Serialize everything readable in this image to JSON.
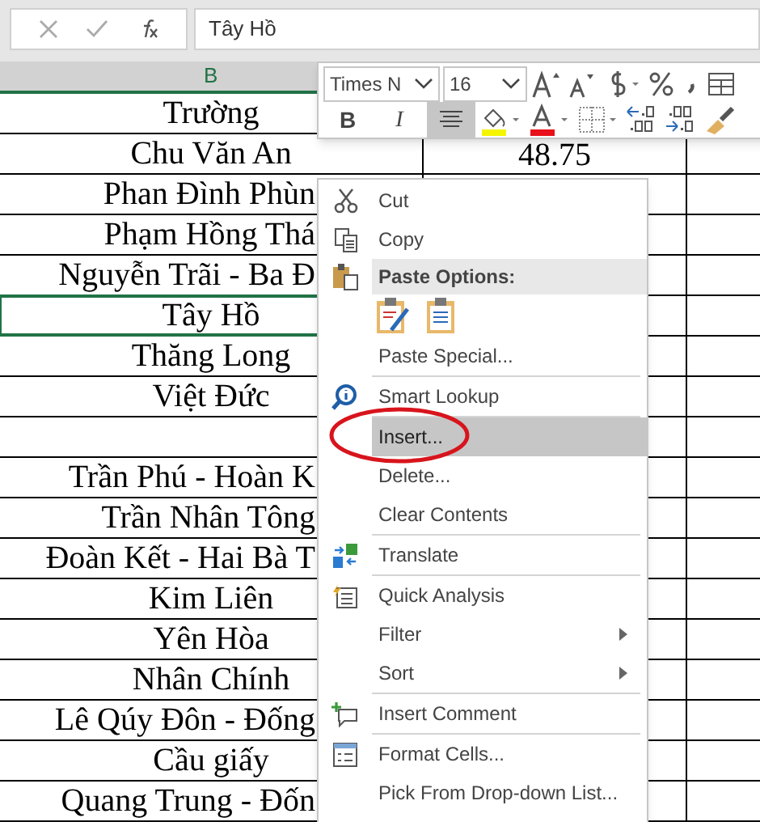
{
  "formula_bar": {
    "value": "Tây Hồ"
  },
  "column_header": {
    "label": "B",
    "selected": true
  },
  "rows": [
    {
      "col_b": "Trường",
      "selected": false
    },
    {
      "col_b": "Chu Văn An",
      "col_c": "48.75",
      "selected": false
    },
    {
      "col_b": "Phan Đình Phùn",
      "selected": false
    },
    {
      "col_b": "Phạm Hồng Thá",
      "selected": false
    },
    {
      "col_b": "Nguyễn Trãi - Ba Đ",
      "selected": false
    },
    {
      "col_b": "Tây Hồ",
      "selected": true
    },
    {
      "col_b": "Thăng Long",
      "selected": false
    },
    {
      "col_b": "Việt Đức",
      "selected": false
    },
    {
      "selected": false
    },
    {
      "col_b": "Trần Phú - Hoàn K",
      "selected": false
    },
    {
      "col_b": "Trần Nhân Tông",
      "selected": false
    },
    {
      "col_b": "Đoàn Kết - Hai Bà T",
      "selected": false
    },
    {
      "col_b": "Kim Liên",
      "selected": false
    },
    {
      "col_b": "Yên Hòa",
      "selected": false
    },
    {
      "col_b": "Nhân Chính",
      "selected": false
    },
    {
      "col_b": "Lê Qúy Đôn - Đống",
      "selected": false
    },
    {
      "col_b": "Cầu giấy",
      "selected": false
    },
    {
      "col_b": "Quang Trung - Đốn",
      "selected": false
    }
  ],
  "mini_toolbar": {
    "font": "Times N",
    "size": "16",
    "format_buttons": [
      {
        "kind": "bold",
        "label": "B",
        "selected": false
      },
      {
        "kind": "italic",
        "label": "I",
        "selected": false
      },
      {
        "kind": "center",
        "selected": true
      }
    ]
  },
  "context_menu": [
    {
      "kind": "command",
      "label": "Cut",
      "selected": false,
      "submenu": false
    },
    {
      "kind": "command",
      "label": "Copy",
      "selected": false,
      "submenu": false
    },
    {
      "kind": "header",
      "label": "Paste Options:"
    },
    {
      "kind": "paste-icons"
    },
    {
      "kind": "command",
      "label": "Paste Special...",
      "selected": false,
      "submenu": false
    },
    {
      "kind": "separator"
    },
    {
      "kind": "command",
      "label": "Smart Lookup",
      "selected": false,
      "submenu": false
    },
    {
      "kind": "separator"
    },
    {
      "kind": "command",
      "label": "Insert...",
      "selected": true,
      "submenu": false
    },
    {
      "kind": "command",
      "label": "Delete...",
      "selected": false,
      "submenu": false
    },
    {
      "kind": "command",
      "label": "Clear Contents",
      "selected": false,
      "submenu": false
    },
    {
      "kind": "separator"
    },
    {
      "kind": "command",
      "label": "Translate",
      "selected": false,
      "submenu": false
    },
    {
      "kind": "separator"
    },
    {
      "kind": "command",
      "label": "Quick Analysis",
      "selected": false,
      "submenu": false
    },
    {
      "kind": "command",
      "label": "Filter",
      "selected": false,
      "submenu": true
    },
    {
      "kind": "command",
      "label": "Sort",
      "selected": false,
      "submenu": true
    },
    {
      "kind": "separator"
    },
    {
      "kind": "command",
      "label": "Insert Comment",
      "selected": false,
      "submenu": false
    },
    {
      "kind": "separator"
    },
    {
      "kind": "command",
      "label": "Format Cells...",
      "selected": false,
      "submenu": false
    },
    {
      "kind": "command",
      "label": "Pick From Drop-down List...",
      "selected": false,
      "submenu": false
    }
  ]
}
